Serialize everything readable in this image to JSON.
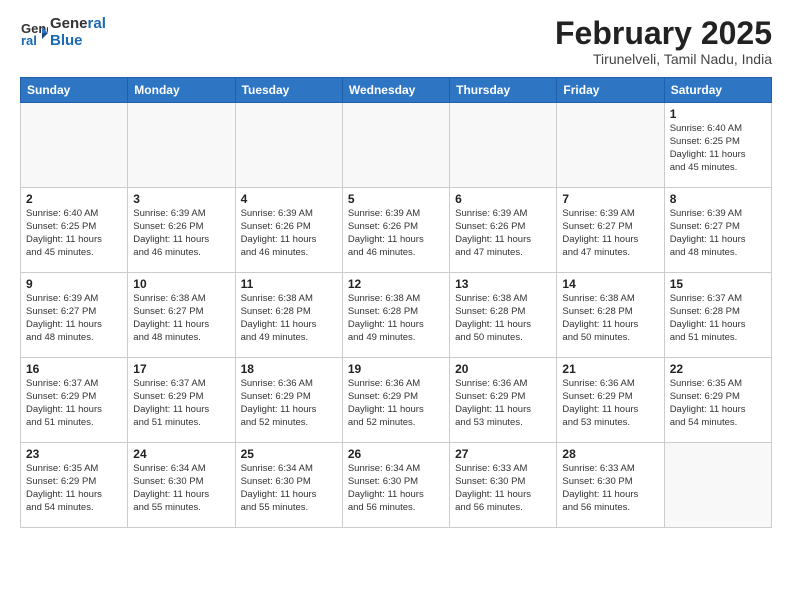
{
  "header": {
    "logo_line1": "General",
    "logo_line2": "Blue",
    "title": "February 2025",
    "subtitle": "Tirunelveli, Tamil Nadu, India"
  },
  "weekdays": [
    "Sunday",
    "Monday",
    "Tuesday",
    "Wednesday",
    "Thursday",
    "Friday",
    "Saturday"
  ],
  "weeks": [
    [
      {
        "day": "",
        "info": ""
      },
      {
        "day": "",
        "info": ""
      },
      {
        "day": "",
        "info": ""
      },
      {
        "day": "",
        "info": ""
      },
      {
        "day": "",
        "info": ""
      },
      {
        "day": "",
        "info": ""
      },
      {
        "day": "1",
        "info": "Sunrise: 6:40 AM\nSunset: 6:25 PM\nDaylight: 11 hours\nand 45 minutes."
      }
    ],
    [
      {
        "day": "2",
        "info": "Sunrise: 6:40 AM\nSunset: 6:25 PM\nDaylight: 11 hours\nand 45 minutes."
      },
      {
        "day": "3",
        "info": "Sunrise: 6:39 AM\nSunset: 6:26 PM\nDaylight: 11 hours\nand 46 minutes."
      },
      {
        "day": "4",
        "info": "Sunrise: 6:39 AM\nSunset: 6:26 PM\nDaylight: 11 hours\nand 46 minutes."
      },
      {
        "day": "5",
        "info": "Sunrise: 6:39 AM\nSunset: 6:26 PM\nDaylight: 11 hours\nand 46 minutes."
      },
      {
        "day": "6",
        "info": "Sunrise: 6:39 AM\nSunset: 6:26 PM\nDaylight: 11 hours\nand 47 minutes."
      },
      {
        "day": "7",
        "info": "Sunrise: 6:39 AM\nSunset: 6:27 PM\nDaylight: 11 hours\nand 47 minutes."
      },
      {
        "day": "8",
        "info": "Sunrise: 6:39 AM\nSunset: 6:27 PM\nDaylight: 11 hours\nand 48 minutes."
      }
    ],
    [
      {
        "day": "9",
        "info": "Sunrise: 6:39 AM\nSunset: 6:27 PM\nDaylight: 11 hours\nand 48 minutes."
      },
      {
        "day": "10",
        "info": "Sunrise: 6:38 AM\nSunset: 6:27 PM\nDaylight: 11 hours\nand 48 minutes."
      },
      {
        "day": "11",
        "info": "Sunrise: 6:38 AM\nSunset: 6:28 PM\nDaylight: 11 hours\nand 49 minutes."
      },
      {
        "day": "12",
        "info": "Sunrise: 6:38 AM\nSunset: 6:28 PM\nDaylight: 11 hours\nand 49 minutes."
      },
      {
        "day": "13",
        "info": "Sunrise: 6:38 AM\nSunset: 6:28 PM\nDaylight: 11 hours\nand 50 minutes."
      },
      {
        "day": "14",
        "info": "Sunrise: 6:38 AM\nSunset: 6:28 PM\nDaylight: 11 hours\nand 50 minutes."
      },
      {
        "day": "15",
        "info": "Sunrise: 6:37 AM\nSunset: 6:28 PM\nDaylight: 11 hours\nand 51 minutes."
      }
    ],
    [
      {
        "day": "16",
        "info": "Sunrise: 6:37 AM\nSunset: 6:29 PM\nDaylight: 11 hours\nand 51 minutes."
      },
      {
        "day": "17",
        "info": "Sunrise: 6:37 AM\nSunset: 6:29 PM\nDaylight: 11 hours\nand 51 minutes."
      },
      {
        "day": "18",
        "info": "Sunrise: 6:36 AM\nSunset: 6:29 PM\nDaylight: 11 hours\nand 52 minutes."
      },
      {
        "day": "19",
        "info": "Sunrise: 6:36 AM\nSunset: 6:29 PM\nDaylight: 11 hours\nand 52 minutes."
      },
      {
        "day": "20",
        "info": "Sunrise: 6:36 AM\nSunset: 6:29 PM\nDaylight: 11 hours\nand 53 minutes."
      },
      {
        "day": "21",
        "info": "Sunrise: 6:36 AM\nSunset: 6:29 PM\nDaylight: 11 hours\nand 53 minutes."
      },
      {
        "day": "22",
        "info": "Sunrise: 6:35 AM\nSunset: 6:29 PM\nDaylight: 11 hours\nand 54 minutes."
      }
    ],
    [
      {
        "day": "23",
        "info": "Sunrise: 6:35 AM\nSunset: 6:29 PM\nDaylight: 11 hours\nand 54 minutes."
      },
      {
        "day": "24",
        "info": "Sunrise: 6:34 AM\nSunset: 6:30 PM\nDaylight: 11 hours\nand 55 minutes."
      },
      {
        "day": "25",
        "info": "Sunrise: 6:34 AM\nSunset: 6:30 PM\nDaylight: 11 hours\nand 55 minutes."
      },
      {
        "day": "26",
        "info": "Sunrise: 6:34 AM\nSunset: 6:30 PM\nDaylight: 11 hours\nand 56 minutes."
      },
      {
        "day": "27",
        "info": "Sunrise: 6:33 AM\nSunset: 6:30 PM\nDaylight: 11 hours\nand 56 minutes."
      },
      {
        "day": "28",
        "info": "Sunrise: 6:33 AM\nSunset: 6:30 PM\nDaylight: 11 hours\nand 56 minutes."
      },
      {
        "day": "",
        "info": ""
      }
    ]
  ]
}
